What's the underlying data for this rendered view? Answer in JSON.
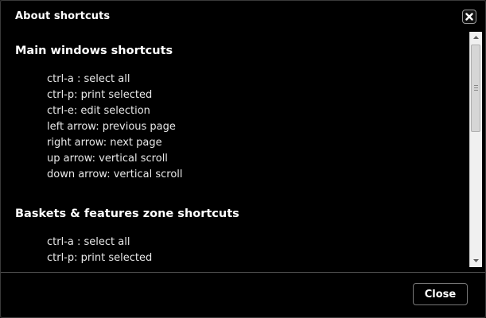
{
  "dialog": {
    "title": "About shortcuts",
    "close_icon": "close-icon",
    "close_button_label": "Close"
  },
  "sections": [
    {
      "title": "Main windows shortcuts",
      "items": [
        "ctrl-a : select all",
        "ctrl-p: print selected",
        "ctrl-e: edit selection",
        "left arrow: previous page",
        "right arrow: next page",
        "up arrow: vertical scroll",
        "down arrow: vertical scroll"
      ]
    },
    {
      "title": "Baskets & features zone shortcuts",
      "items": [
        "ctrl-a : select all",
        "ctrl-p: print selected"
      ]
    }
  ],
  "colors": {
    "background": "#000000",
    "text": "#ffffff",
    "scrollbar": "#f0f0f0"
  }
}
